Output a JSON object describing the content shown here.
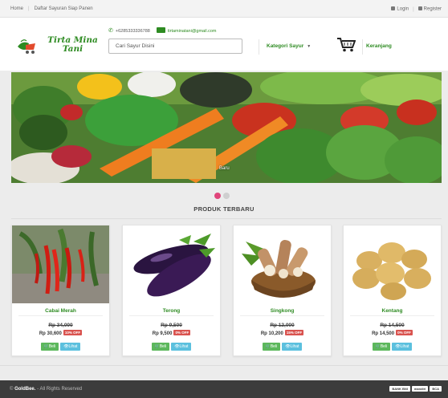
{
  "topbar": {
    "home": "Home",
    "tagline": "Daftar Sayuran Siap Panen",
    "login": "Login",
    "register": "Register"
  },
  "brand": {
    "name_line1": "Tirta Mina",
    "name_line2": "Tani",
    "color": "#2e8b22"
  },
  "contact": {
    "phone": "+6285333336788",
    "email": "tirtaminatani@gmail.com"
  },
  "search": {
    "placeholder": "Cari Sayur Disini"
  },
  "nav": {
    "kategori": "Kategori Sayur",
    "cart": "Keranjang"
  },
  "banner": {
    "caption": "Baru",
    "slides": 2,
    "active_slide": 1
  },
  "section": {
    "title": "PRODUK TERBARU"
  },
  "products": [
    {
      "name": "Cabai Merah",
      "old_price": "Rp 34,000",
      "new_price": "Rp 30,600",
      "discount": "10% OFF",
      "image": "red-chili"
    },
    {
      "name": "Terong",
      "old_price": "Rp 9,500",
      "new_price": "Rp 9,500",
      "discount": "0% OFF",
      "image": "eggplant"
    },
    {
      "name": "Singkong",
      "old_price": "Rp 12,000",
      "new_price": "Rp 10,200",
      "discount": "15% OFF",
      "image": "cassava"
    },
    {
      "name": "Kentang",
      "old_price": "Rp 14,500",
      "new_price": "Rp 14,500",
      "discount": "0% OFF",
      "image": "potato"
    }
  ],
  "buttons": {
    "buy": "Beli",
    "view": "Lihat"
  },
  "footer": {
    "brand": "GoldBee.",
    "text": "All Rights Reserved",
    "banks": [
      "BANK BNI",
      "mandiri",
      "BCA"
    ]
  }
}
